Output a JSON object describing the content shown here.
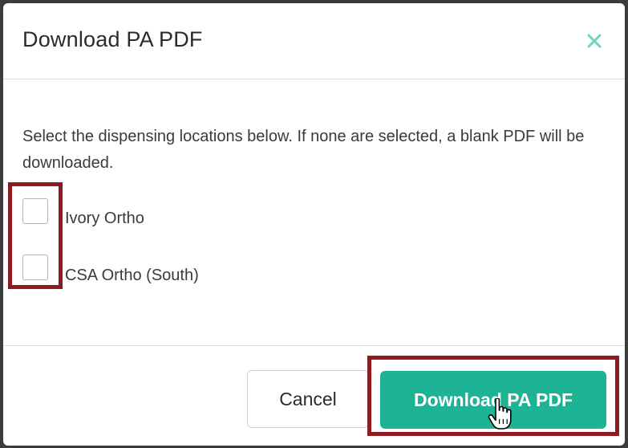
{
  "dialog": {
    "title": "Download PA PDF",
    "close_icon": "close-x-icon",
    "description": "Select the dispensing locations below. If none are selected, a blank PDF will be downloaded.",
    "locations": [
      {
        "label": "Ivory Ortho",
        "checked": false
      },
      {
        "label": "CSA Ortho (South)",
        "checked": false
      }
    ],
    "buttons": {
      "cancel_label": "Cancel",
      "download_label": "Download PA PDF"
    }
  },
  "colors": {
    "accent": "#1db394",
    "close_icon": "#6fd3bd",
    "highlight": "#8e1a22"
  },
  "cursor_icon": "hand-pointer-icon"
}
